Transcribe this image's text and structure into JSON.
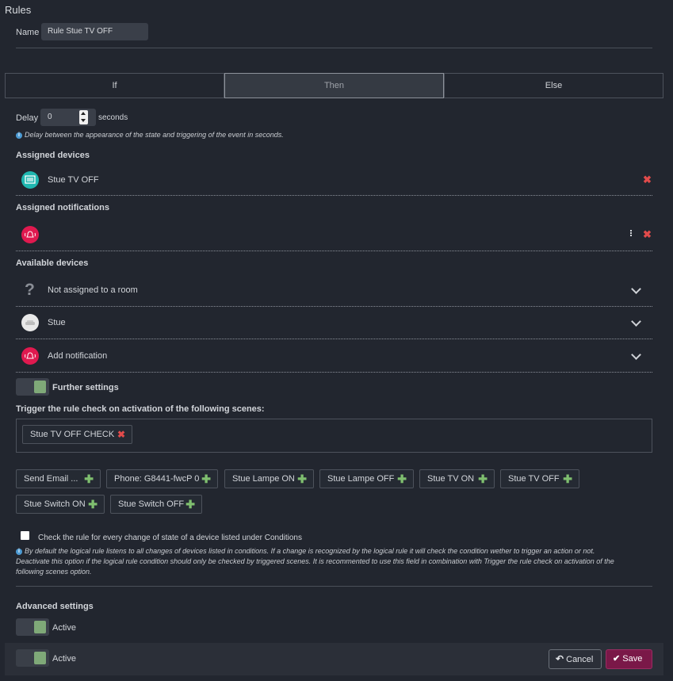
{
  "page": {
    "title": "Rules"
  },
  "name_field": {
    "label": "Name",
    "value": "Rule Stue TV OFF"
  },
  "tabs": [
    {
      "label": "If",
      "active": false
    },
    {
      "label": "Then",
      "active": true
    },
    {
      "label": "Else",
      "active": false
    }
  ],
  "delay": {
    "label": "Delay",
    "value": "0",
    "unit": "seconds",
    "hint": "Delay between the appearance of the state and triggering of the event in seconds."
  },
  "assigned_devices": {
    "heading": "Assigned devices",
    "items": [
      {
        "label": "Stue TV OFF",
        "icon": "tv-scene-icon",
        "color": "#1fb7b0"
      }
    ]
  },
  "assigned_notifications": {
    "heading": "Assigned notifications",
    "items": [
      {
        "label": "",
        "icon": "bell-icon",
        "color": "#e0194f"
      }
    ]
  },
  "available_devices": {
    "heading": "Available devices",
    "items": [
      {
        "label": "Not assigned to a room",
        "icon": "question-icon"
      },
      {
        "label": "Stue",
        "icon": "sofa-icon"
      },
      {
        "label": "Add notification",
        "icon": "bell-icon"
      }
    ]
  },
  "further_settings": {
    "label": "Further settings",
    "enabled": true
  },
  "trigger_scenes": {
    "heading": "Trigger the rule check on activation of the following scenes:",
    "selected": [
      "Stue TV OFF CHECK"
    ],
    "available": [
      "Send Email ...",
      "Phone: G8441-fwcP 0",
      "Stue Lampe ON",
      "Stue Lampe OFF",
      "Stue TV ON",
      "Stue TV OFF",
      "Stue Switch ON",
      "Stue Switch OFF"
    ]
  },
  "check_every_change": {
    "label": "Check the rule for every change of state of a device listed under Conditions",
    "checked": false,
    "hint_line1": "By default the logical rule listens to all changes of devices listed in conditions. If a change is recognized by the logical rule it will check the condition wether to trigger an action or not.",
    "hint_line2": "Deactivate this option if the logical rule condition should only be checked by triggered scenes. It is recommented to use this field in combination with Trigger the rule check on activation of the",
    "hint_line3": "following scenes option."
  },
  "advanced_settings": {
    "heading": "Advanced settings",
    "active_label": "Active",
    "enabled": true
  },
  "footer": {
    "active_label": "Active",
    "cancel_label": "Cancel",
    "save_label": "Save"
  },
  "colors": {
    "background": "#22262f",
    "accent_save": "#7a1848",
    "toggle_on": "#7fa978",
    "remove": "#e24b4b",
    "add": "#7fbf6f",
    "info": "#4c9ad3"
  }
}
